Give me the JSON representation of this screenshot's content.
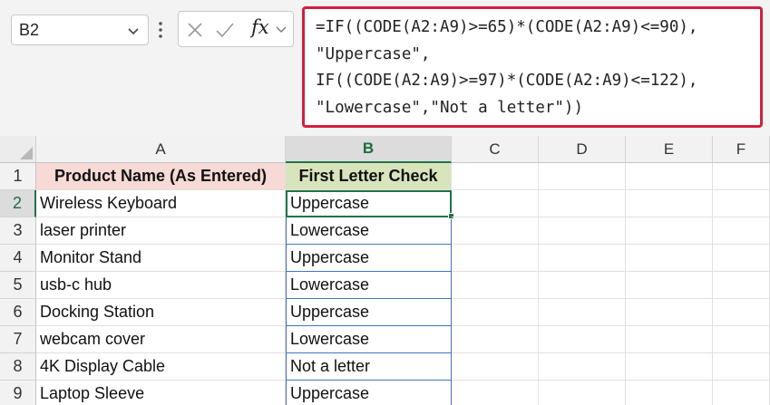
{
  "name_box": {
    "value": "B2"
  },
  "formula_bar": {
    "lines": [
      "=IF((CODE(A2:A9)>=65)*(CODE(A2:A9)<=90),",
      "\"Uppercase\",",
      "IF((CODE(A2:A9)>=97)*(CODE(A2:A9)<=122),",
      "\"Lowercase\",\"Not a letter\"))"
    ],
    "fx_label": "fx"
  },
  "columns": [
    "A",
    "B",
    "C",
    "D",
    "E",
    "F"
  ],
  "rows": [
    "1",
    "2",
    "3",
    "4",
    "5",
    "6",
    "7",
    "8",
    "9"
  ],
  "header_row": {
    "a": "Product Name (As Entered)",
    "b": "First Letter Check"
  },
  "data_rows": [
    {
      "a": "Wireless Keyboard",
      "b": "Uppercase"
    },
    {
      "a": "laser printer",
      "b": "Lowercase"
    },
    {
      "a": "Monitor Stand",
      "b": "Uppercase"
    },
    {
      "a": "usb-c hub",
      "b": "Lowercase"
    },
    {
      "a": "Docking Station",
      "b": "Uppercase"
    },
    {
      "a": "webcam cover",
      "b": "Lowercase"
    },
    {
      "a": "4K Display Cable",
      "b": "Not a letter"
    },
    {
      "a": "Laptop Sleeve",
      "b": "Uppercase"
    }
  ],
  "selection": {
    "active_cell": "B2"
  },
  "colors": {
    "formula_highlight": "#d11f3f",
    "header_a_fill": "#f7d9d6",
    "header_b_fill": "#d8e4bc",
    "selection_green": "#217346",
    "spill_border_blue": "#4472c4"
  }
}
